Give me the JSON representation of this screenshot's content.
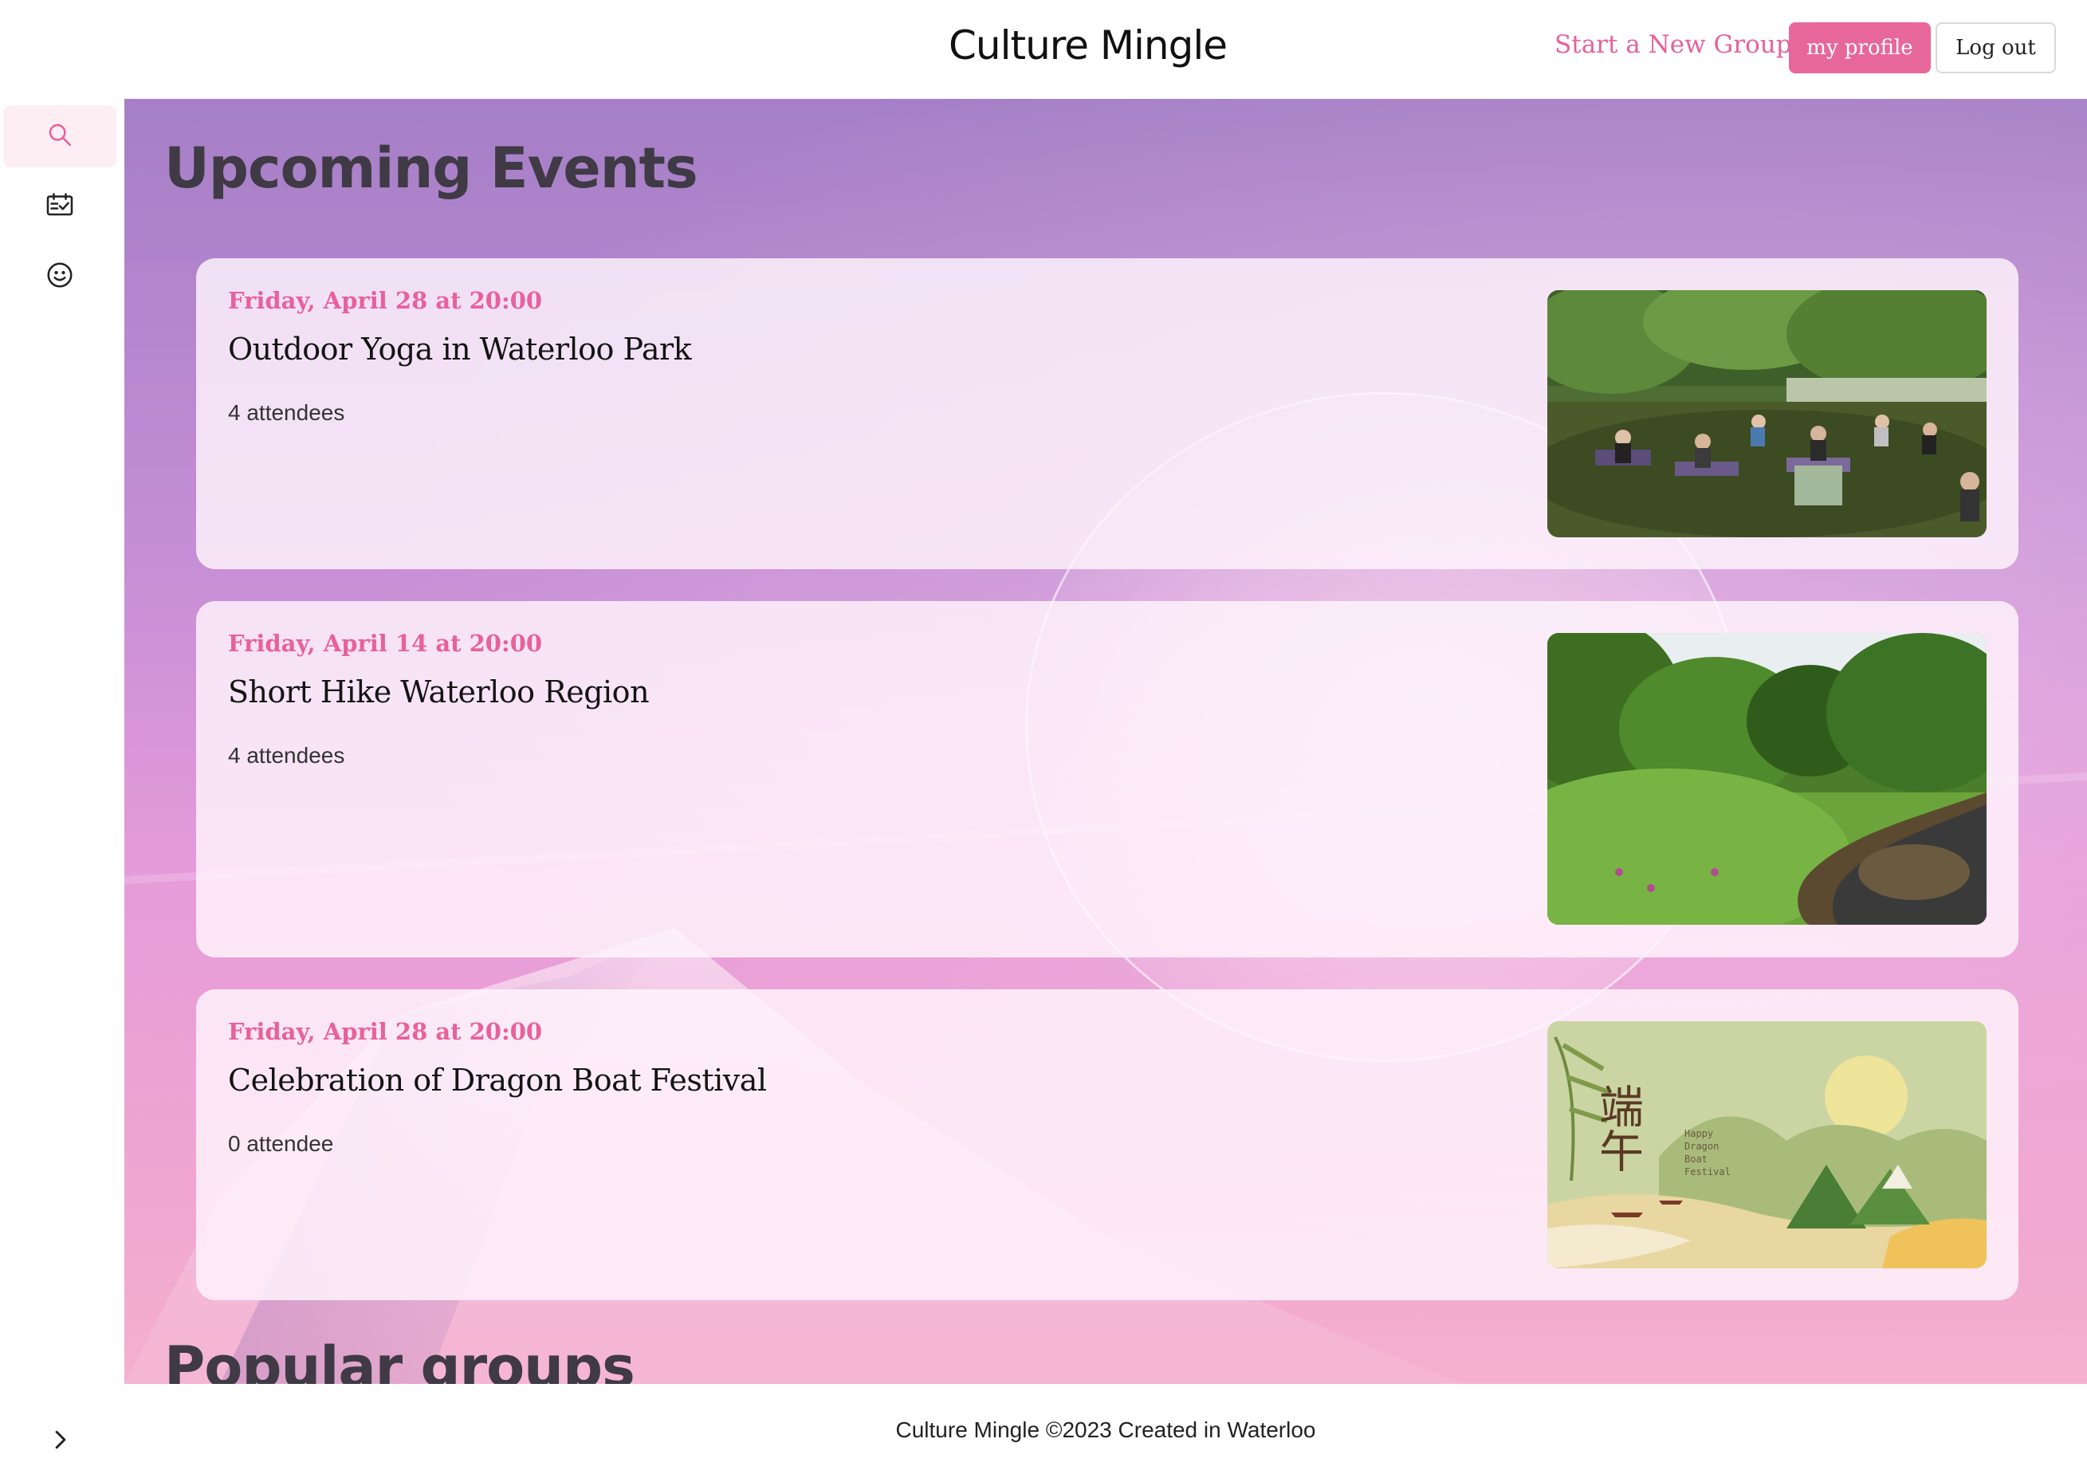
{
  "header": {
    "app_title": "Culture Mingle",
    "start_group_label": "Start a New Group",
    "profile_label": "my profile",
    "logout_label": "Log out"
  },
  "sidebar": {
    "items": [
      {
        "icon": "search-icon",
        "active": true
      },
      {
        "icon": "calendar-check-icon",
        "active": false
      },
      {
        "icon": "smiley-icon",
        "active": false
      }
    ],
    "collapse_icon": "chevron-right-icon"
  },
  "main": {
    "upcoming_title": "Upcoming Events",
    "popular_title": "Popular groups",
    "events": [
      {
        "date": "Friday, April 28 at 20:00",
        "name": "Outdoor Yoga in Waterloo Park",
        "attendees": "4 attendees",
        "image": "yoga-park-photo"
      },
      {
        "date": "Friday, April 14 at 20:00",
        "name": "Short Hike Waterloo Region",
        "attendees": "4 attendees",
        "image": "hike-creek-photo"
      },
      {
        "date": "Friday, April 28 at 20:00",
        "name": "Celebration of Dragon Boat Festival",
        "attendees": "0 attendee",
        "image": "dragon-boat-illustration"
      }
    ],
    "dragon_image_text": {
      "characters": "端午",
      "caption_lines": [
        "Happy",
        "Dragon",
        "Boat",
        "Festival"
      ]
    }
  },
  "footer": {
    "text": "Culture Mingle ©2023 Created in Waterloo"
  },
  "colors": {
    "accent": "#e8619a",
    "button_pink": "#e8679b",
    "heading": "#3f3a45"
  }
}
